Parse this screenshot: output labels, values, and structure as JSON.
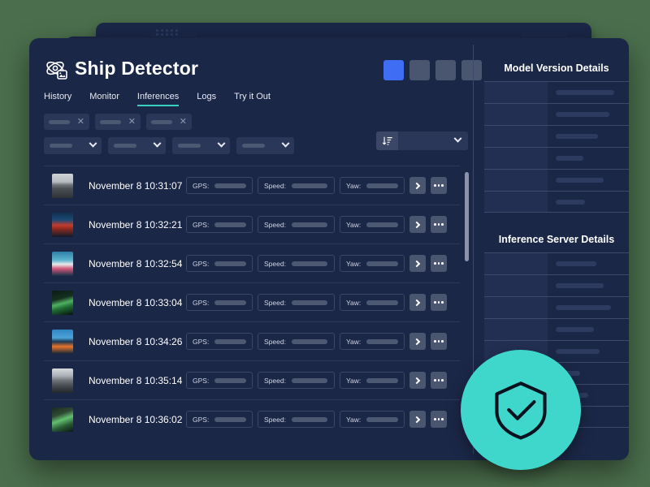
{
  "theme": {
    "page_background": "#4b6f4d",
    "window_background": "#1b2747",
    "accent_teal": "#35d0c0",
    "badge_teal": "#3fd6cc",
    "active_swatch_blue": "#3f6ef5",
    "muted_bar": "#4d5873"
  },
  "header": {
    "logo_icon": "atom-image-icon",
    "title": "Ship Detector",
    "swatches": [
      {
        "name": "swatch-blue",
        "color": "#3f6ef5",
        "active": true
      },
      {
        "name": "swatch-slate-1",
        "color": "#4a5570",
        "active": false
      },
      {
        "name": "swatch-slate-2",
        "color": "#4a5570",
        "active": false
      },
      {
        "name": "swatch-slate-3",
        "color": "#4a5570",
        "active": false
      }
    ]
  },
  "nav": {
    "items": [
      {
        "label": "History",
        "active": false
      },
      {
        "label": "Monitor",
        "active": false
      },
      {
        "label": "Inferences",
        "active": true
      },
      {
        "label": "Logs",
        "active": false
      },
      {
        "label": "Try it Out",
        "active": false
      }
    ]
  },
  "filters": {
    "chips": [
      {
        "name": "filter-chip-1",
        "remove_icon": "close-icon"
      },
      {
        "name": "filter-chip-2",
        "remove_icon": "close-icon"
      },
      {
        "name": "filter-chip-3",
        "remove_icon": "close-icon"
      }
    ],
    "dropdowns": [
      {
        "name": "filter-dropdown-1",
        "chevron_icon": "chevron-down-icon"
      },
      {
        "name": "filter-dropdown-2",
        "chevron_icon": "chevron-down-icon"
      },
      {
        "name": "filter-dropdown-3",
        "chevron_icon": "chevron-down-icon"
      },
      {
        "name": "filter-dropdown-4",
        "chevron_icon": "chevron-down-icon"
      }
    ],
    "sort": {
      "name": "sort-select",
      "icon": "sort-descending-icon",
      "chevron_icon": "chevron-down-icon",
      "value": ""
    }
  },
  "list": {
    "metric_labels": {
      "gps": "GPS:",
      "speed": "Speed:",
      "yaw": "Yaw:"
    },
    "row_actions": {
      "open": "chevron-right-icon",
      "more": "ellipsis-icon"
    },
    "rows": [
      {
        "timestamp": "November 8 10:31:07",
        "thumb": "battleship-grayscale"
      },
      {
        "timestamp": "November 8 10:32:21",
        "thumb": "container-ship-red"
      },
      {
        "timestamp": "November 8 10:32:54",
        "thumb": "supply-vessel-pink"
      },
      {
        "timestamp": "November 8 10:33:04",
        "thumb": "green-hull-aerial"
      },
      {
        "timestamp": "November 8 10:34:26",
        "thumb": "orange-tug-boat"
      },
      {
        "timestamp": "November 8 10:35:14",
        "thumb": "navy-destroyer-bow"
      },
      {
        "timestamp": "November 8 10:36:02",
        "thumb": "green-net-trawler"
      }
    ]
  },
  "right_panel": {
    "sections": [
      {
        "title": "Model Version Details",
        "rows": [
          {
            "bar": 72
          },
          {
            "bar": 66
          },
          {
            "bar": 52
          },
          {
            "bar": 34
          },
          {
            "bar": 59
          },
          {
            "bar": 36
          }
        ]
      },
      {
        "title": "Inference Server Details",
        "rows": [
          {
            "bar": 50
          },
          {
            "bar": 59
          },
          {
            "bar": 68
          },
          {
            "bar": 47
          },
          {
            "bar": 54
          },
          {
            "bar": 30
          },
          {
            "bar": 40
          },
          {
            "bar": 26
          }
        ]
      }
    ]
  },
  "badge": {
    "name": "security-shield-badge",
    "icon": "shield-check-icon"
  }
}
